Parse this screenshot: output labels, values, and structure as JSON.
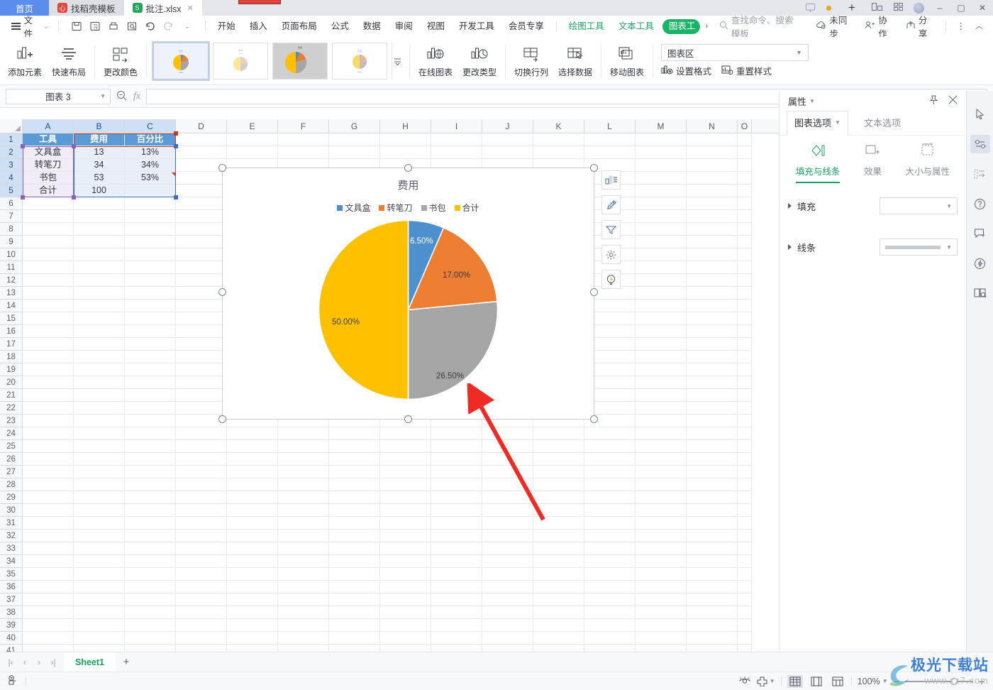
{
  "window": {
    "tabs": [
      {
        "label": "首页",
        "icon": "home-icon",
        "type": "home"
      },
      {
        "label": "找稻壳模板",
        "icon": "docer-icon",
        "type": "tpl"
      },
      {
        "label": "批注.xlsx",
        "icon": "sheet-icon",
        "type": "doc"
      }
    ],
    "tab_icons": {
      "monitor": "monitor-icon",
      "dot": "status-dot-icon",
      "new_tab": "+"
    },
    "controls": {
      "minimize": "–",
      "maximize": "▢",
      "close": "✕"
    }
  },
  "menubar": {
    "file_label": "文件",
    "quick_icons": [
      "save-icon",
      "save-as-icon",
      "print-icon",
      "print-preview-icon",
      "undo-icon",
      "redo-icon",
      "customize-icon"
    ],
    "items": [
      "开始",
      "插入",
      "页面布局",
      "公式",
      "数据",
      "审阅",
      "视图",
      "开发工具",
      "会员专享"
    ],
    "context_tabs": [
      "绘图工具",
      "文本工具"
    ],
    "active_context_tab": "图表工",
    "overflow": "›",
    "search_placeholder": "查找命令、搜索模板",
    "right_items": [
      {
        "label": "未同步",
        "icon": "cloud-sync-icon"
      },
      {
        "label": "协作",
        "icon": "collaborate-icon"
      },
      {
        "label": "分享",
        "icon": "share-icon"
      }
    ],
    "more": "⋮",
    "collapse": "︿"
  },
  "ribbon": {
    "buttons": [
      {
        "label": "添加元素",
        "icon": "add-element-icon",
        "dropdown": true
      },
      {
        "label": "快速布局",
        "icon": "quick-layout-icon",
        "dropdown": true
      },
      {
        "label": "更改颜色",
        "icon": "change-color-icon",
        "dropdown": true
      }
    ],
    "gallery": [
      {
        "name": "style-1",
        "selected": true
      },
      {
        "name": "style-2",
        "selected": false
      },
      {
        "name": "style-3",
        "selected": false
      },
      {
        "name": "style-4",
        "selected": false
      }
    ],
    "gallery_more": "more-styles-icon",
    "buttons2": [
      {
        "label": "在线图表",
        "icon": "online-chart-icon",
        "dropdown": true
      },
      {
        "label": "更改类型",
        "icon": "change-type-icon",
        "dropdown": false
      },
      {
        "label": "切换行列",
        "icon": "switch-row-col-icon",
        "dropdown": false
      },
      {
        "label": "选择数据",
        "icon": "select-data-icon",
        "dropdown": false
      },
      {
        "label": "移动图表",
        "icon": "move-chart-icon",
        "dropdown": false
      }
    ],
    "chart_area_select": "图表区",
    "format_label": "设置格式",
    "reset_label": "重置样式"
  },
  "formula_bar": {
    "name_box": "图表 3",
    "zoom_icon": "zoom-out-icon",
    "fx": "fx",
    "value": ""
  },
  "grid": {
    "columns": [
      "A",
      "B",
      "C",
      "D",
      "E",
      "F",
      "G",
      "H",
      "I",
      "J",
      "K",
      "L",
      "M",
      "N",
      "O"
    ],
    "selected_columns": [
      "A",
      "B",
      "C"
    ],
    "row_count": 41,
    "data": [
      {
        "row": 1,
        "cells": [
          "工具",
          "费用",
          "百分比"
        ],
        "style": "header"
      },
      {
        "row": 2,
        "cells": [
          "文具盒",
          "13",
          "13%"
        ],
        "style": "data"
      },
      {
        "row": 3,
        "cells": [
          "转笔刀",
          "34",
          "34%"
        ],
        "style": "data"
      },
      {
        "row": 4,
        "cells": [
          "书包",
          "53",
          "53%"
        ],
        "style": "data"
      },
      {
        "row": 5,
        "cells": [
          "合计",
          "100",
          ""
        ],
        "style": "data"
      }
    ]
  },
  "chart_data": {
    "type": "pie",
    "title": "费用",
    "categories": [
      "文具盒",
      "转笔刀",
      "书包",
      "合计"
    ],
    "values": [
      13,
      34,
      53,
      100
    ],
    "labels": [
      "6.50%",
      "17.00%",
      "26.50%",
      "50.00%"
    ],
    "percents": [
      6.5,
      17.0,
      26.5,
      50.0
    ],
    "colors": [
      "#4e8fcd",
      "#ed7d31",
      "#a5a5a5",
      "#ffc000"
    ],
    "legend_position": "top",
    "grid": false,
    "xlabel": "",
    "ylabel": ""
  },
  "chart_float_tools": [
    {
      "name": "chart-elements-icon"
    },
    {
      "name": "chart-style-brush-icon"
    },
    {
      "name": "chart-filter-icon"
    },
    {
      "name": "chart-settings-gear-icon"
    },
    {
      "name": "chart-smart-bulb-icon"
    }
  ],
  "properties_panel": {
    "title": "属性",
    "pin_icon": "pin-icon",
    "close_icon": "close-icon",
    "tabs": [
      {
        "label": "图表选项",
        "active": true,
        "has_dropdown": true
      },
      {
        "label": "文本选项",
        "active": false,
        "has_dropdown": false
      }
    ],
    "subtabs": [
      {
        "label": "填充与线条",
        "icon": "fill-line-icon",
        "active": true
      },
      {
        "label": "效果",
        "icon": "effects-icon",
        "active": false
      },
      {
        "label": "大小与属性",
        "icon": "size-properties-icon",
        "active": false
      }
    ],
    "sections": [
      {
        "label": "填充",
        "control": "color-dropdown",
        "value": ""
      },
      {
        "label": "线条",
        "control": "line-dropdown",
        "value": ""
      }
    ],
    "accent_color": "#19a15e"
  },
  "side_toolbar": [
    {
      "name": "cursor-select-icon",
      "active": false
    },
    {
      "name": "properties-slider-icon",
      "active": true
    },
    {
      "name": "cell-format-icon",
      "active": false
    },
    {
      "name": "help-question-icon",
      "active": false
    },
    {
      "name": "feedback-icon",
      "active": false
    },
    {
      "name": "lightning-idea-icon",
      "active": false
    },
    {
      "name": "book-search-icon",
      "active": false
    }
  ],
  "sheet_bar": {
    "nav": [
      "|‹",
      "‹",
      "›",
      "›|"
    ],
    "sheets": [
      "Sheet1"
    ],
    "active_sheet": "Sheet1",
    "add_label": "+"
  },
  "status_bar": {
    "left_icons": [
      "record-macro-icon"
    ],
    "eye_icon": "eye-icon",
    "layout_icon": "page-layout-icon",
    "views": [
      {
        "name": "normal-view-icon",
        "active": true
      },
      {
        "name": "page-break-view-icon",
        "active": false
      },
      {
        "name": "page-layout-view-icon",
        "active": false
      }
    ],
    "zoom": "100%",
    "zoom_out": "−",
    "zoom_in": "+"
  },
  "watermark": {
    "line1": "极光下载站",
    "line2": "www.xz7.com"
  }
}
